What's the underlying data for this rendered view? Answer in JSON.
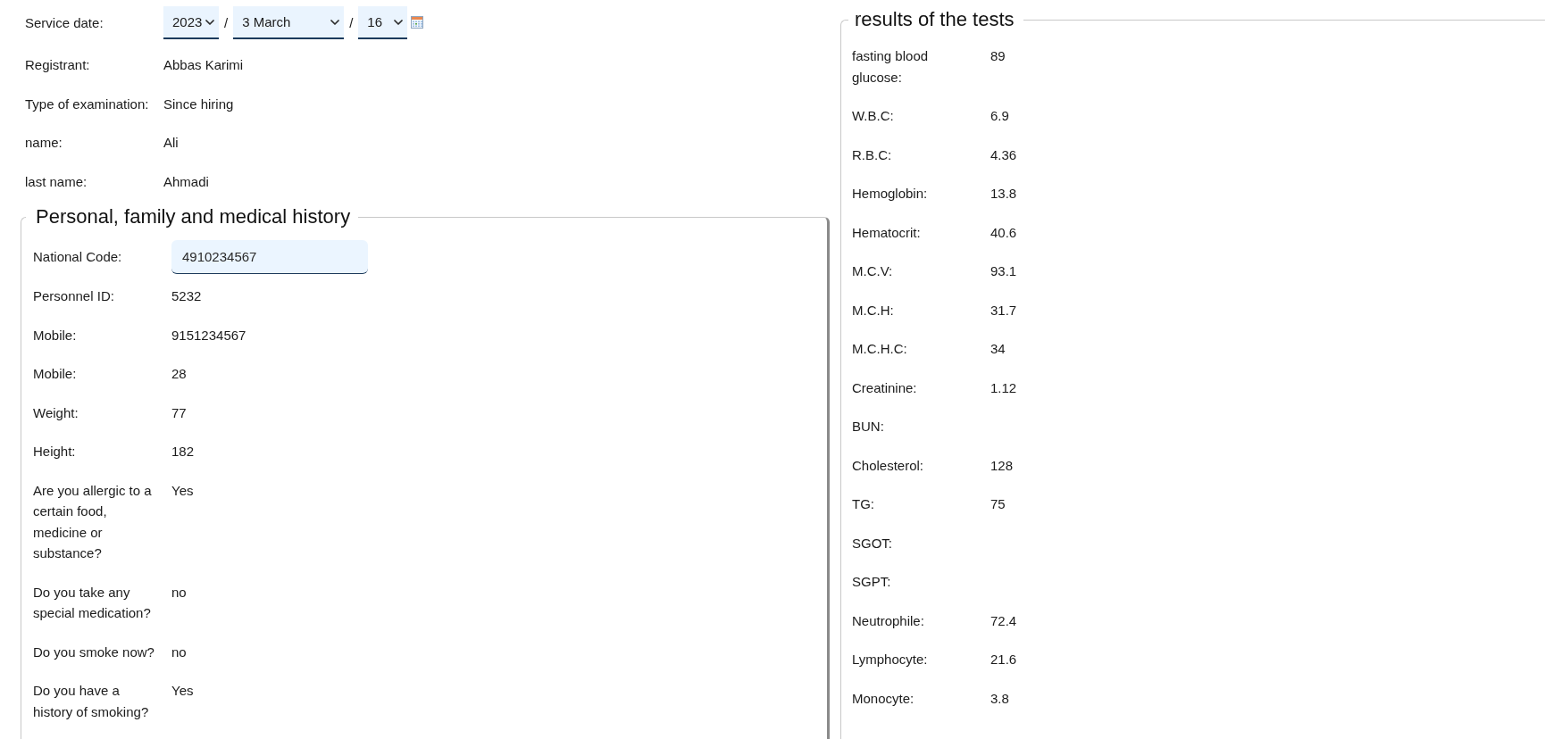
{
  "header_fields": [
    {
      "label": "Service date:",
      "kind": "date",
      "parts": [
        {
          "kind": "select",
          "value": "2023"
        },
        {
          "kind": "separator",
          "text": "/"
        },
        {
          "kind": "select",
          "value": "3 March"
        },
        {
          "kind": "separator",
          "text": "/"
        },
        {
          "kind": "select",
          "value": "16"
        }
      ]
    },
    {
      "label": "Registrant:",
      "kind": "text",
      "value": "Abbas Karimi"
    },
    {
      "label": "Type of examination:",
      "kind": "text",
      "value": "Since hiring"
    },
    {
      "label": "name:",
      "kind": "text",
      "value": "Ali"
    },
    {
      "label": "last name:",
      "kind": "text",
      "value": "Ahmadi"
    }
  ],
  "history": {
    "title": "Personal, family and medical history",
    "fields": [
      {
        "label": "National Code:",
        "kind": "input",
        "value": "4910234567"
      },
      {
        "label": "Personnel ID:",
        "kind": "text",
        "value": "5232"
      },
      {
        "label": "Mobile:",
        "kind": "text",
        "value": "9151234567"
      },
      {
        "label": "Mobile:",
        "kind": "text",
        "value": "28"
      },
      {
        "label": "Weight:",
        "kind": "text",
        "value": "77"
      },
      {
        "label": "Height:",
        "kind": "text",
        "value": "182"
      },
      {
        "label": "Are you allergic to a certain food, medicine or substance?",
        "kind": "text",
        "value": "Yes"
      },
      {
        "label": "Do you take any special medication?",
        "kind": "text",
        "value": "no"
      },
      {
        "label": "Do you smoke now?",
        "kind": "text",
        "value": "no"
      },
      {
        "label": "Do you have a history of smoking?",
        "kind": "text",
        "value": "Yes"
      }
    ]
  },
  "test_results": {
    "title": "results of the tests",
    "fields": [
      {
        "label": "fasting blood glucose:",
        "value": "89"
      },
      {
        "label": "W.B.C:",
        "value": "6.9"
      },
      {
        "label": "R.B.C:",
        "value": "4.36"
      },
      {
        "label": "Hemoglobin:",
        "value": "13.8"
      },
      {
        "label": "Hematocrit:",
        "value": "40.6"
      },
      {
        "label": "M.C.V:",
        "value": "93.1"
      },
      {
        "label": "M.C.H:",
        "value": "31.7"
      },
      {
        "label": "M.C.H.C:",
        "value": "34"
      },
      {
        "label": "Creatinine:",
        "value": "1.12"
      },
      {
        "label": "BUN:"
      },
      {
        "label": "Cholesterol:",
        "value": "128"
      },
      {
        "label": "TG:",
        "value": "75"
      },
      {
        "label": "SGOT:"
      },
      {
        "label": "SGPT:"
      },
      {
        "label": "Neutrophile:",
        "value": "72.4"
      },
      {
        "label": "Lymphocyte:",
        "value": "21.6"
      },
      {
        "label": "Monocyte:",
        "value": "3.8"
      }
    ]
  }
}
